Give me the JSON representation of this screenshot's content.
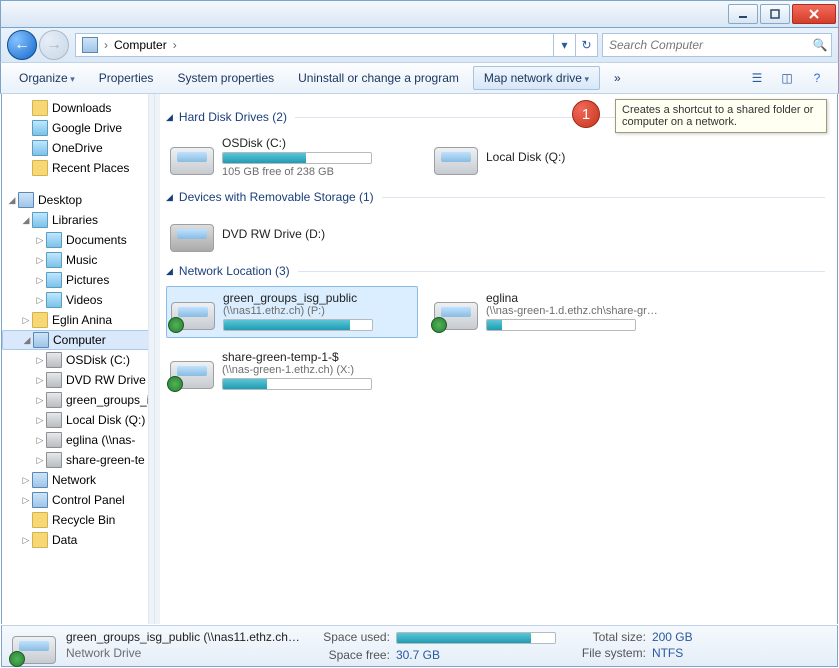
{
  "window": {
    "minimize": "",
    "maximize": "",
    "close": ""
  },
  "breadcrumb": {
    "root": "Computer",
    "sep": "›"
  },
  "search": {
    "placeholder": "Search Computer"
  },
  "toolbar": {
    "organize": "Organize",
    "properties": "Properties",
    "system_properties": "System properties",
    "uninstall": "Uninstall or change a program",
    "map_drive": "Map network drive",
    "overflow": "»"
  },
  "tooltip": {
    "map_drive": "Creates a shortcut to a shared folder or computer on a network."
  },
  "badge": {
    "num": "1"
  },
  "tree": [
    {
      "label": "Downloads",
      "depth": 1,
      "cls": ""
    },
    {
      "label": "Google Drive",
      "depth": 1,
      "cls": "lib"
    },
    {
      "label": "OneDrive",
      "depth": 1,
      "cls": "lib"
    },
    {
      "label": "Recent Places",
      "depth": 1,
      "cls": ""
    },
    {
      "label": "",
      "depth": 0,
      "cls": "blank"
    },
    {
      "label": "Desktop",
      "depth": 0,
      "cls": "comp",
      "exp": "◢"
    },
    {
      "label": "Libraries",
      "depth": 1,
      "cls": "lib",
      "exp": "◢"
    },
    {
      "label": "Documents",
      "depth": 2,
      "cls": "lib",
      "exp": "▷"
    },
    {
      "label": "Music",
      "depth": 2,
      "cls": "lib",
      "exp": "▷"
    },
    {
      "label": "Pictures",
      "depth": 2,
      "cls": "lib",
      "exp": "▷"
    },
    {
      "label": "Videos",
      "depth": 2,
      "cls": "lib",
      "exp": "▷"
    },
    {
      "label": "Eglin  Anina",
      "depth": 1,
      "cls": "",
      "exp": "▷"
    },
    {
      "label": "Computer",
      "depth": 1,
      "cls": "comp",
      "exp": "◢",
      "sel": true
    },
    {
      "label": "OSDisk (C:)",
      "depth": 2,
      "cls": "drive",
      "exp": "▷"
    },
    {
      "label": "DVD RW Drive (",
      "depth": 2,
      "cls": "drive",
      "exp": "▷"
    },
    {
      "label": "green_groups_i",
      "depth": 2,
      "cls": "drive",
      "exp": "▷"
    },
    {
      "label": "Local Disk (Q:)",
      "depth": 2,
      "cls": "drive",
      "exp": "▷"
    },
    {
      "label": "eglina (\\\\nas-",
      "depth": 2,
      "cls": "drive",
      "exp": "▷"
    },
    {
      "label": "share-green-te",
      "depth": 2,
      "cls": "drive",
      "exp": "▷"
    },
    {
      "label": "Network",
      "depth": 1,
      "cls": "comp",
      "exp": "▷"
    },
    {
      "label": "Control Panel",
      "depth": 1,
      "cls": "comp",
      "exp": "▷"
    },
    {
      "label": "Recycle Bin",
      "depth": 1,
      "cls": ""
    },
    {
      "label": "Data",
      "depth": 1,
      "cls": "",
      "exp": "▷"
    }
  ],
  "groups": {
    "hdd": {
      "title": "Hard Disk Drives (2)"
    },
    "rem": {
      "title": "Devices with Removable Storage (1)"
    },
    "net": {
      "title": "Network Location (3)"
    }
  },
  "drives": {
    "osdisk": {
      "title": "OSDisk (C:)",
      "sub": "105 GB free of 238 GB",
      "fill": 56
    },
    "localq": {
      "title": "Local Disk (Q:)"
    },
    "dvd": {
      "title": "DVD RW Drive (D:)"
    },
    "p": {
      "title": "green_groups_isg_public",
      "sub": "(\\\\nas11.ethz.ch) (P:)",
      "fill": 85
    },
    "eglina": {
      "title": "eglina",
      "sub": "(\\\\nas-green-1.d.ethz.ch\\share-gr…",
      "fill": 10
    },
    "x": {
      "title": "share-green-temp-1-$",
      "sub": "(\\\\nas-green-1.ethz.ch) (X:)",
      "fill": 30
    }
  },
  "status": {
    "title": "green_groups_isg_public (\\\\nas11.ethz.ch…",
    "type": "Network Drive",
    "space_used_label": "Space used:",
    "space_free_label": "Space free:",
    "space_free": "30.7 GB",
    "total_size_label": "Total size:",
    "total_size": "200 GB",
    "fs_label": "File system:",
    "fs": "NTFS",
    "bar_fill": 85
  }
}
